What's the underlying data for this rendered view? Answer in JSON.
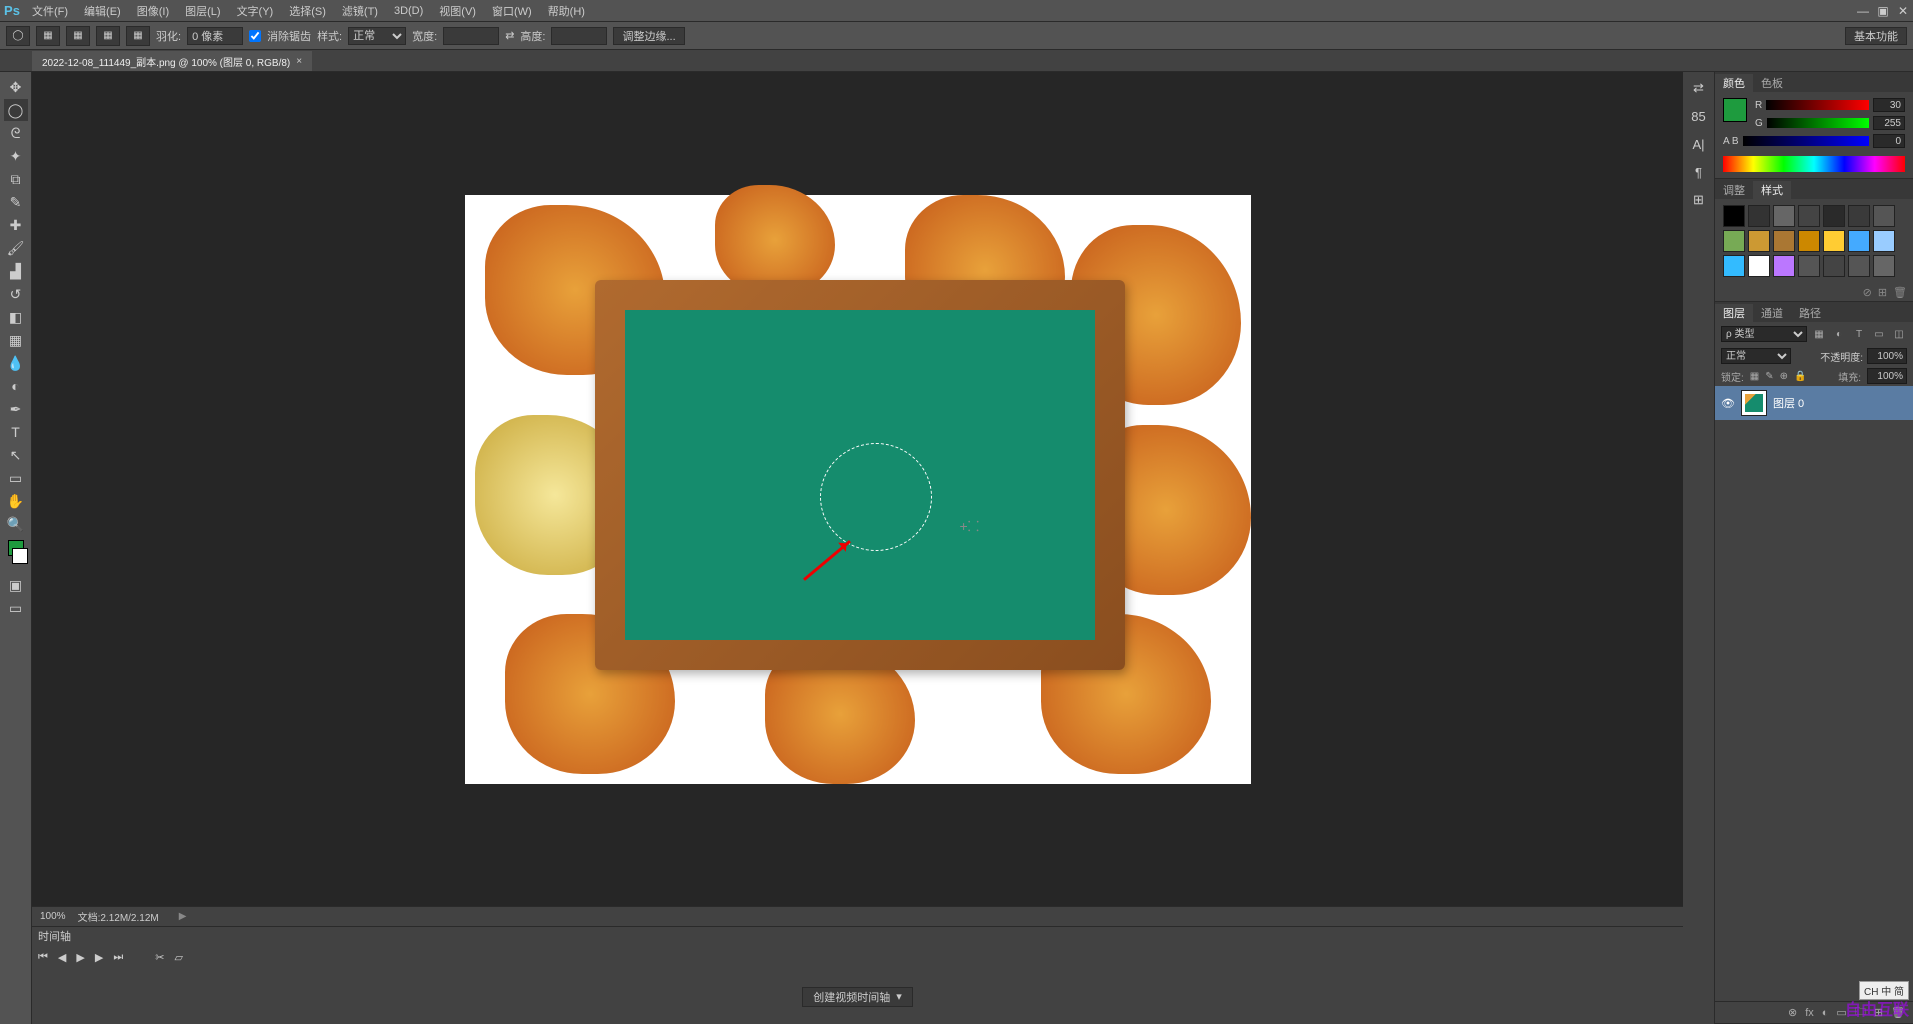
{
  "app": {
    "logo": "Ps"
  },
  "menu": {
    "file": "文件(F)",
    "edit": "编辑(E)",
    "image": "图像(I)",
    "layer": "图层(L)",
    "type": "文字(Y)",
    "select": "选择(S)",
    "filter": "滤镜(T)",
    "threeD": "3D(D)",
    "view": "视图(V)",
    "window": "窗口(W)",
    "help": "帮助(H)"
  },
  "window_controls": {
    "min": "—",
    "max": "▣",
    "close": "✕"
  },
  "options": {
    "feather_label": "羽化:",
    "feather_value": "0 像素",
    "antialias_label": "消除锯齿",
    "style_label": "样式:",
    "style_value": "正常",
    "width_label": "宽度:",
    "width_value": "",
    "swap_icon": "⇄",
    "height_label": "高度:",
    "height_value": "",
    "refine_edge": "调整边缘...",
    "workspace": "基本功能"
  },
  "document": {
    "tab_title": "2022-12-08_111449_副本.png @ 100% (图层 0, RGB/8)",
    "tab_close": "×"
  },
  "status": {
    "zoom": "100%",
    "doc_size": "文档:2.12M/2.12M"
  },
  "timeline": {
    "title": "时间轴",
    "create_button": "创建视频时间轴"
  },
  "panel_icons": [
    "⇄",
    "85",
    "A|",
    "¶",
    "⊞"
  ],
  "color_panel": {
    "tab_color": "颜色",
    "tab_swatch": "色板",
    "r_label": "R",
    "r_value": "30",
    "g_label": "G",
    "g_value": "255",
    "b_label": "B",
    "b_value": "0",
    "ab_label": "A B"
  },
  "styles_panel": {
    "tab_adjust": "调整",
    "tab_styles": "样式",
    "colors": [
      "#000",
      "#333",
      "#666",
      "#444",
      "#2a2a2a",
      "#3a3a3a",
      "#555",
      "#7a5",
      "#c93",
      "#a73",
      "#c80",
      "#fc3",
      "#4af",
      "#9cf",
      "#3bf",
      "#fff",
      "#b7f",
      "#555",
      "#444",
      "#555",
      "#666"
    ]
  },
  "layers_panel": {
    "tab_layers": "图层",
    "tab_channels": "通道",
    "tab_paths": "路径",
    "filter_kind": "ρ 类型",
    "filter_icons": [
      "▦",
      "◐",
      "T",
      "▭",
      "◫"
    ],
    "blend_mode": "正常",
    "opacity_label": "不透明度:",
    "opacity_value": "100%",
    "lock_label": "锁定:",
    "lock_icons": [
      "▦",
      "✎",
      "⊕",
      "🔒"
    ],
    "fill_label": "填充:",
    "fill_value": "100%",
    "layer0_name": "图层 0",
    "footer_icons": [
      "⊗",
      "fx",
      "◐",
      "▭",
      "🗀",
      "⊞",
      "🗑"
    ]
  },
  "watermark": "自由互联",
  "ime_hint": "CH 中 简"
}
